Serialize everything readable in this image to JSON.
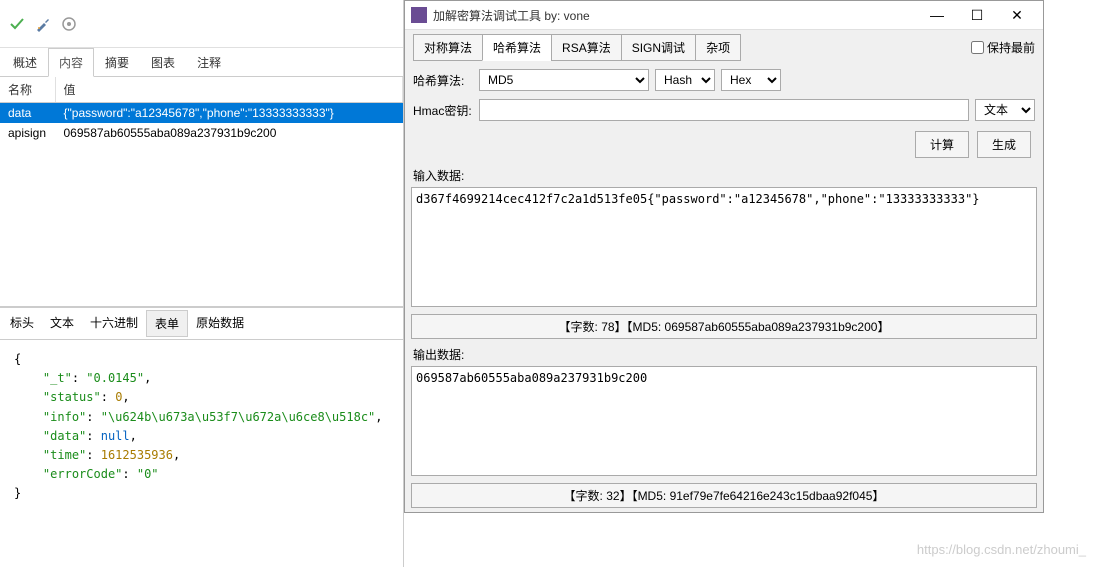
{
  "left": {
    "top_tabs": [
      "概述",
      "内容",
      "摘要",
      "图表",
      "注释"
    ],
    "active_tab": 1,
    "table": {
      "cols": [
        "名称",
        "值"
      ],
      "rows": [
        {
          "name": "data",
          "value": "{\"password\":\"a12345678\",\"phone\":\"13333333333\"}",
          "selected": true
        },
        {
          "name": "apisign",
          "value": "069587ab60555aba089a237931b9c200",
          "selected": false
        }
      ]
    },
    "bottom_tabs": [
      "标头",
      "文本",
      "十六进制",
      "表单",
      "原始数据"
    ],
    "bottom_active": 3,
    "json": {
      "k_t": "_t",
      "v_t": "\"0.0145\"",
      "k_status": "status",
      "v_status": "0",
      "k_info": "info",
      "v_info": "\"\\u624b\\u673a\\u53f7\\u672a\\u6ce8\\u518c\"",
      "k_data": "data",
      "v_data": "null",
      "k_time": "time",
      "v_time": "1612535936",
      "k_errorCode": "errorCode",
      "v_errorCode": "\"0\""
    }
  },
  "right": {
    "title": "加解密算法调试工具  by: vone",
    "keep_front": "保持最前",
    "tool_tabs": [
      "对称算法",
      "哈希算法",
      "RSA算法",
      "SIGN调试",
      "杂项"
    ],
    "tool_active": 1,
    "form": {
      "hash_label": "哈希算法:",
      "hash_value": "MD5",
      "mode_value": "Hash",
      "enc_value": "Hex",
      "hmac_label": "Hmac密钥:",
      "hmac_value": "",
      "hmac_type": "文本"
    },
    "btn_calc": "计算",
    "btn_gen": "生成",
    "input_label": "输入数据:",
    "input_data": "d367f4699214cec412f7c2a1d513fe05{\"password\":\"a12345678\",\"phone\":\"13333333333\"}",
    "status1": "【字数: 78】【MD5: 069587ab60555aba089a237931b9c200】",
    "output_label": "输出数据:",
    "output_data": "069587ab60555aba089a237931b9c200",
    "status2": "【字数: 32】【MD5: 91ef79e7fe64216e243c15dbaa92f045】"
  },
  "watermark": "https://blog.csdn.net/zhoumi_"
}
